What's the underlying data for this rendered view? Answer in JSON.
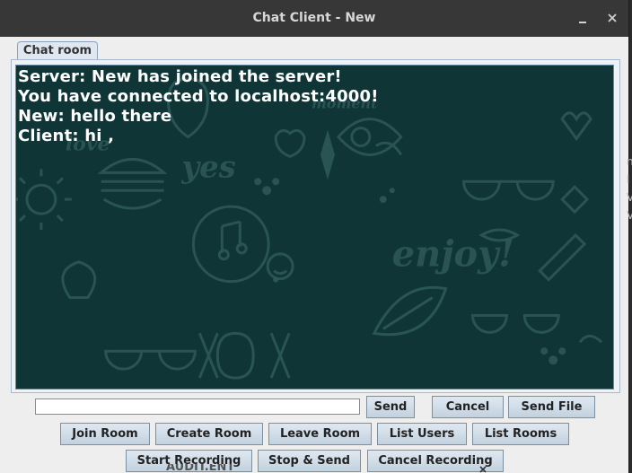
{
  "window": {
    "title": "Chat Client - New",
    "minimize_label": "",
    "close_glyph": "×"
  },
  "tabs": [
    {
      "label": "Chat room"
    }
  ],
  "chat": {
    "messages": [
      "Server: New has joined the server!",
      "You have connected to localhost:4000!",
      "New: hello there",
      "Client: hi ,"
    ],
    "background_color": "#0f3537",
    "wallpaper_words": [
      "yes",
      "enjoy!",
      "XOXO",
      "love",
      "moment"
    ]
  },
  "input": {
    "value": "",
    "placeholder": ""
  },
  "buttons": {
    "send": "Send",
    "cancel": "Cancel",
    "send_file": "Send File",
    "join_room": "Join Room",
    "create_room": "Create Room",
    "leave_room": "Leave Room",
    "list_users": "List Users",
    "list_rooms": "List Rooms",
    "start_recording": "Start Recording",
    "stop_send": "Stop & Send",
    "cancel_recording": "Cancel Recording"
  },
  "overlapped_text": "AUDIT.ENT",
  "side_text": "n\nl\nV\nV"
}
